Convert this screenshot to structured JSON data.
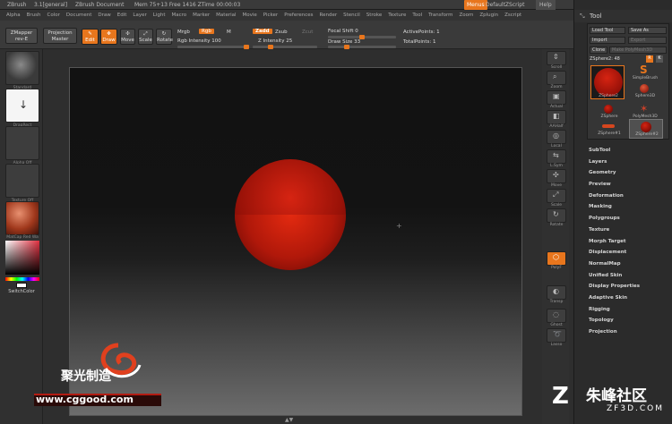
{
  "title": {
    "app": "ZBrush",
    "doc_name": "3.1[general]",
    "doc_label": "ZBrush Document",
    "mem": "Mem 75+13 Free 1416 ZTime 00:00:03",
    "menus_btn": "Menus",
    "script": "DefaultZScript",
    "help": "Help"
  },
  "menubar": [
    "Alpha",
    "Brush",
    "Color",
    "Document",
    "Draw",
    "Edit",
    "Layer",
    "Light",
    "Macro",
    "Marker",
    "Material",
    "Movie",
    "Picker",
    "Preferences",
    "Render",
    "Stencil",
    "Stroke",
    "Texture",
    "Tool",
    "Transform",
    "Zoom",
    "Zplugin",
    "Zscript"
  ],
  "toolbar": {
    "zmapper": "ZMapper",
    "zmapper_sub": "rev-E",
    "projection": "Projection",
    "projection_sub": "Master",
    "edit": "Edit",
    "draw": "Draw",
    "move": "Move",
    "scale": "Scale",
    "rotate": "Rotate",
    "mrgb": "Mrgb",
    "rgb": "Rgb",
    "m": "M",
    "rgb_intensity": "Rgb Intensity 100",
    "zadd": "Zadd",
    "zsub": "Zsub",
    "zcut": "Zcut",
    "z_intensity": "Z Intensity 25",
    "focal_shift": "Focal Shift 0",
    "draw_size": "Draw Size 33",
    "active_points": "ActivePoints: 1",
    "total_points": "TotalPoints: 1",
    "rgb_intensity_value": 100,
    "z_intensity_value": 25,
    "focal_shift_value": 0,
    "draw_size_value": 33
  },
  "left_panel": {
    "brush_label": "Standard",
    "stroke_label": "DragRect",
    "alpha_label": "Alpha Off",
    "texture_label": "Texture Off",
    "material_label": "MatCap Red Wa",
    "switch_color": "SwitchColor"
  },
  "shelf": [
    "Scroll",
    "Zoom",
    "Actual",
    "AAHalf",
    "Local",
    "L.Sym",
    "Move",
    "Scale",
    "Rotate",
    "PolyF",
    "Transp",
    "Ghost",
    "Lasso"
  ],
  "tray": {
    "title": "Tool",
    "load_tool": "Load Tool",
    "save_as": "Save As",
    "import": "Import",
    "export": "Export",
    "clone": "Clone",
    "make_polymesh": "Make PolyMesh3D",
    "current": "ZSphere2: 48",
    "r_btn": "R",
    "k_btn": "K",
    "thumbs": [
      "ZSphere2",
      "SimpleBrush",
      "Sphere3D",
      "ZSphere",
      "PolyMesh3D",
      "ZSphere#1",
      "ZSphere#2"
    ],
    "menu": [
      "SubTool",
      "Layers",
      "Geometry",
      "Preview",
      "Deformation",
      "Masking",
      "Polygroups",
      "Texture",
      "Morph Target",
      "Displacement",
      "NormalMap",
      "Unified Skin",
      "Display Properties",
      "Adaptive Skin",
      "Rigging",
      "Topology",
      "Projection"
    ]
  },
  "watermark": {
    "cn_text": "聚光制造",
    "url": "www.cggood.com",
    "site_cn": "朱峰社区",
    "site": "ZF3D.COM"
  },
  "colors": {
    "accent": "#e8761d",
    "sphere": "#b01a0a"
  }
}
